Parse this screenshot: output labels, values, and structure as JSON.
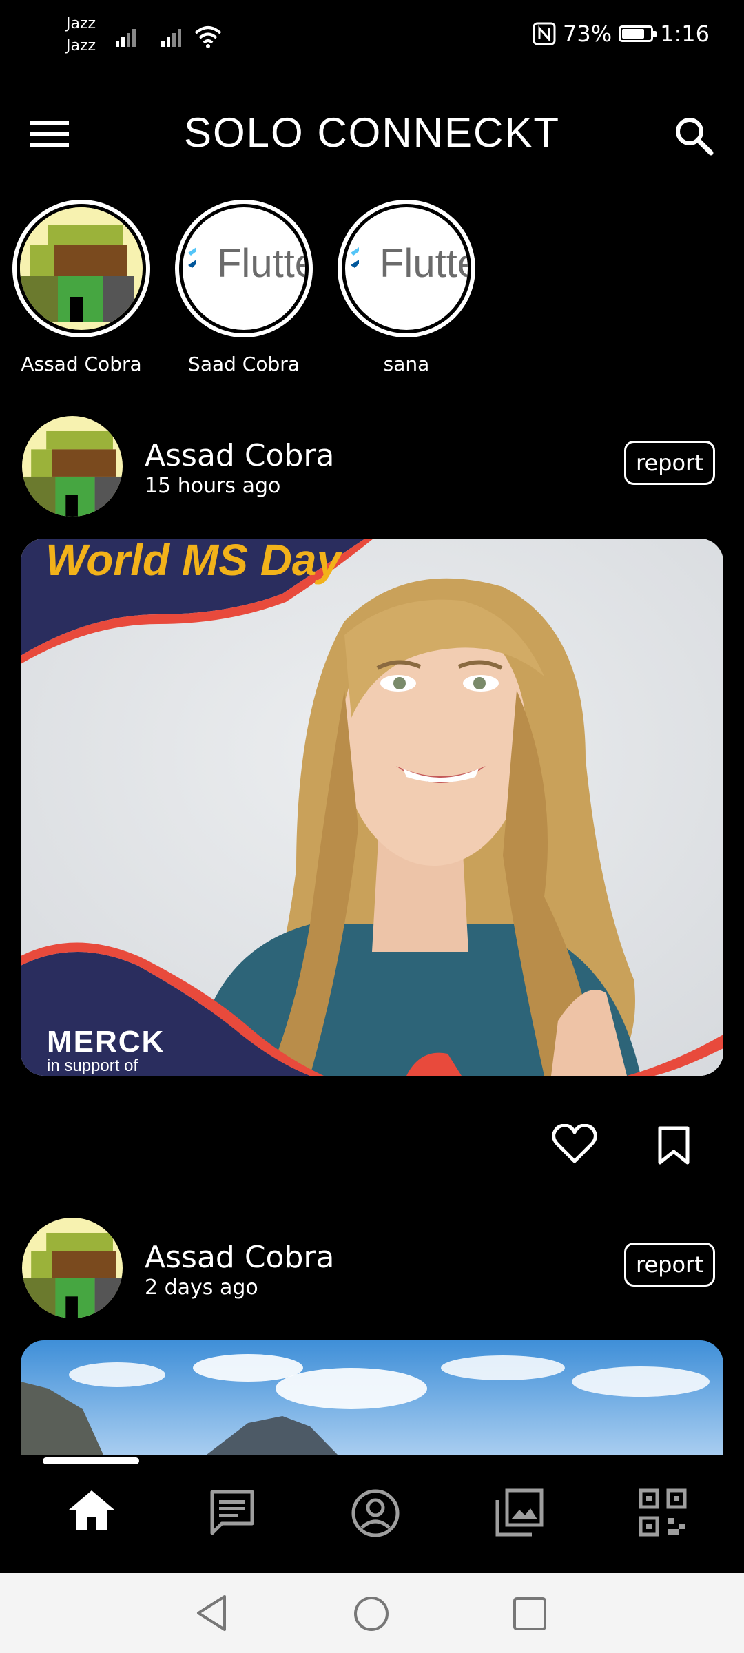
{
  "status_bar": {
    "carrier_1": "Jazz",
    "carrier_2": "Jazz",
    "battery_percent": "73%",
    "battery_level": 0.73,
    "time": "1:16"
  },
  "app_bar": {
    "title": "SOLO CONNECKT",
    "menu_icon": "menu-icon",
    "search_icon": "search-icon"
  },
  "stories": [
    {
      "name": "Assad Cobra",
      "avatar": "pixel-avatar"
    },
    {
      "name": "Saad Cobra",
      "avatar_text": "Flutte"
    },
    {
      "name": "sana",
      "avatar_text": "Flutte"
    }
  ],
  "posts": [
    {
      "author": "Assad Cobra",
      "time": "15 hours ago",
      "report_label": "report",
      "image": {
        "headline": "World MS Day",
        "brand": "MERCK",
        "tagline": "in support of"
      },
      "actions": [
        "heart-icon",
        "bookmark-icon"
      ]
    },
    {
      "author": "Assad Cobra",
      "time": "2 days ago",
      "report_label": "report"
    }
  ],
  "bottom_nav": [
    "home-icon",
    "chat-icon",
    "profile-icon",
    "gallery-icon",
    "qr-code-icon"
  ],
  "colors": {
    "background": "#000000",
    "text": "#ffffff",
    "banner_navy": "#2a2d5e",
    "banner_red": "#e84a3c",
    "headline_yellow": "#f2b21a"
  }
}
